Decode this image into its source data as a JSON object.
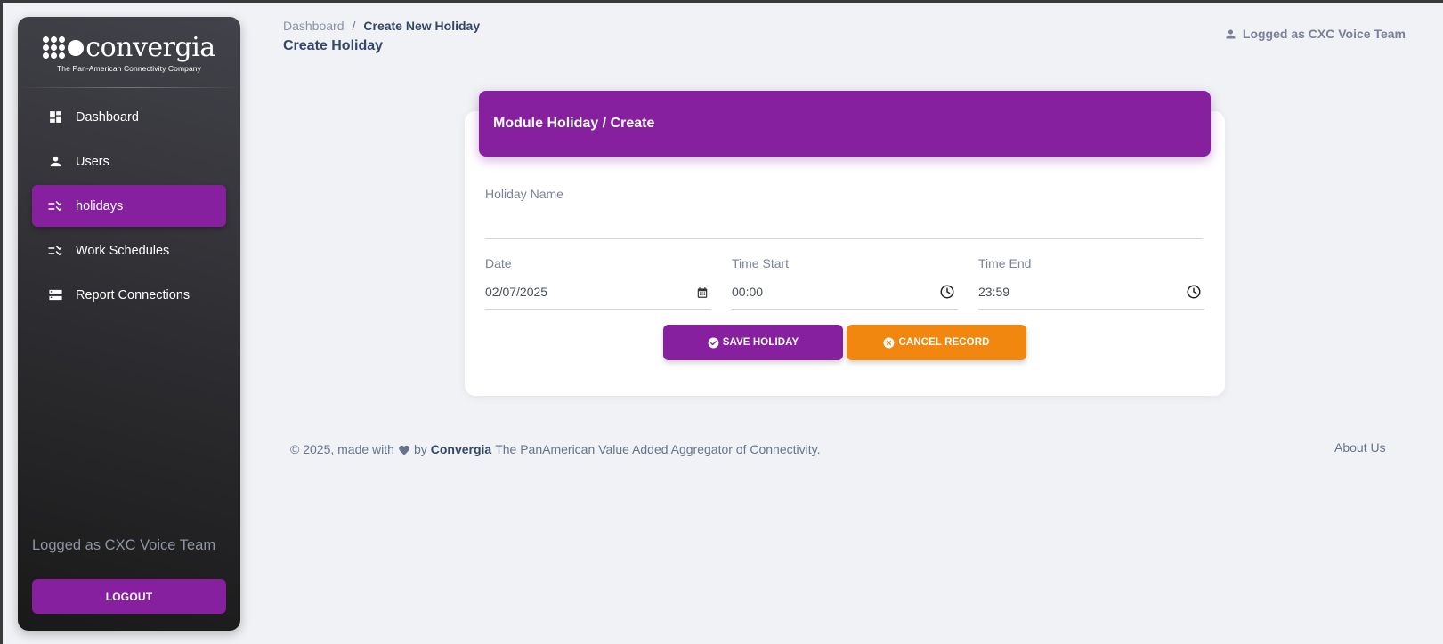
{
  "sidebar": {
    "brand_name": "convergia",
    "brand_tagline": "The Pan-American Connectivity Company",
    "items": [
      {
        "label": "Dashboard",
        "icon": "dashboard-icon"
      },
      {
        "label": "Users",
        "icon": "person-icon"
      },
      {
        "label": "holidays",
        "icon": "checklist-icon",
        "active": true
      },
      {
        "label": "Work Schedules",
        "icon": "checklist-icon"
      },
      {
        "label": "Report Connections",
        "icon": "storage-icon"
      }
    ],
    "user_text": "Logged as CXC Voice Team",
    "logout_label": "LOGOUT"
  },
  "header": {
    "breadcrumb": [
      "Dashboard",
      "Create New Holiday"
    ],
    "breadcrumb_sep": "/",
    "title": "Create Holiday",
    "user_text": "Logged as CXC Voice Team"
  },
  "card": {
    "title": "Module Holiday / Create",
    "holiday_name": {
      "label": "Holiday Name",
      "value": ""
    },
    "date": {
      "label": "Date",
      "value": "02/07/2025"
    },
    "time_start": {
      "label": "Time Start",
      "value": "00:00"
    },
    "time_end": {
      "label": "Time End",
      "value": "23:59"
    },
    "save_label": "SAVE HOLIDAY",
    "cancel_label": "CANCEL RECORD"
  },
  "footer": {
    "prefix": "© 2025, made with",
    "by": "by",
    "brand": "Convergia",
    "suffix": "The PanAmerican Value Added Aggregator of Connectivity.",
    "about": "About Us"
  },
  "colors": {
    "primary": "#86209f",
    "warning": "#f1870f",
    "background": "#f0f2f5"
  }
}
